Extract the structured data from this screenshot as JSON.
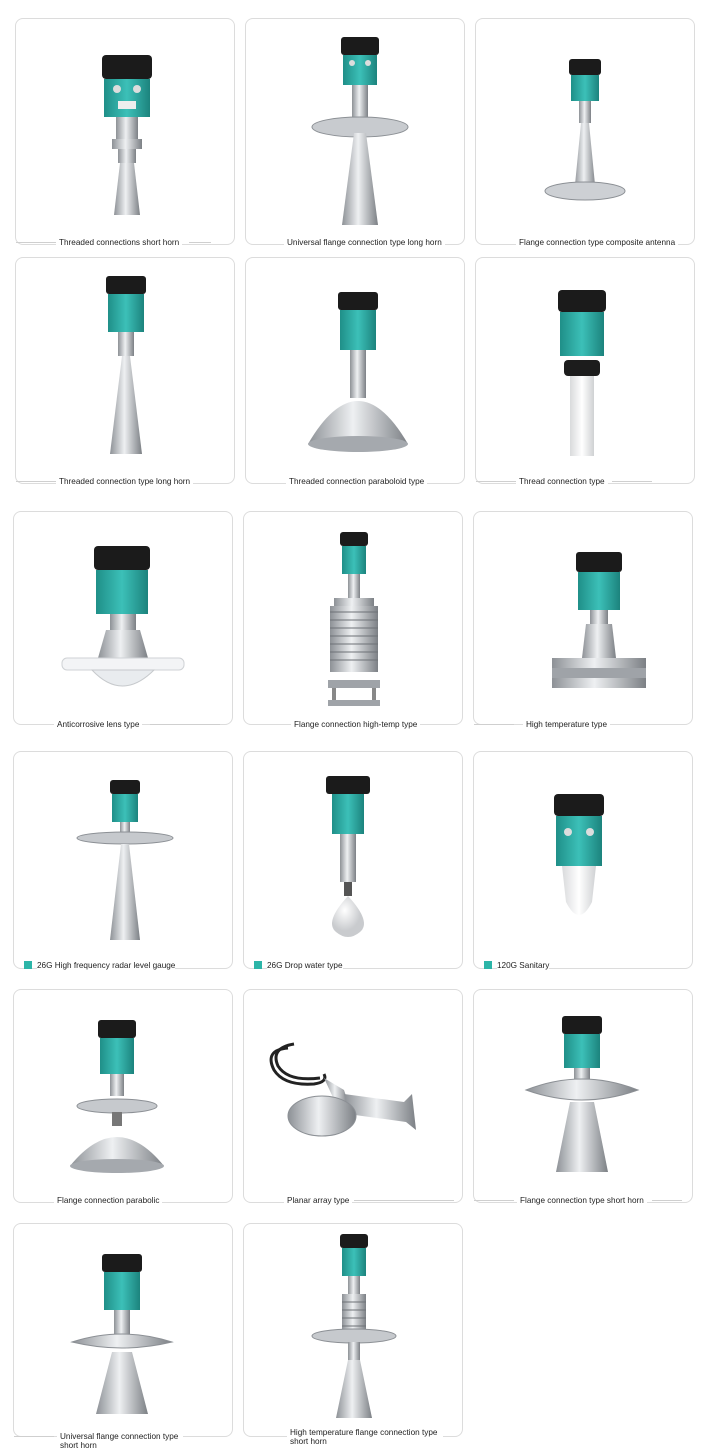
{
  "products": [
    {
      "label": "Threaded connections short horn",
      "tag": false,
      "antenna": "short-horn-thread"
    },
    {
      "label": "Universal flange connection type long horn",
      "tag": false,
      "antenna": "long-horn-flange"
    },
    {
      "label": "Flange connection type composite antenna",
      "tag": false,
      "antenna": "composite-flange"
    },
    {
      "label": "Threaded connection type long horn",
      "tag": false,
      "antenna": "long-horn-thread"
    },
    {
      "label": "Threaded connection paraboloid type",
      "tag": false,
      "antenna": "paraboloid-thread"
    },
    {
      "label": "Thread connection type",
      "tag": false,
      "antenna": "rod-thread"
    },
    {
      "label": "Anticorrosive lens type",
      "tag": false,
      "antenna": "lens"
    },
    {
      "label": "Flange connection high-temp type",
      "tag": false,
      "antenna": "bellows-hightemp"
    },
    {
      "label": "High temperature type",
      "tag": false,
      "antenna": "hightemp-flange"
    },
    {
      "label": "26G High frequency radar level gauge",
      "tag": true,
      "antenna": "26g-horn"
    },
    {
      "label": "26G Drop water type",
      "tag": true,
      "antenna": "drop"
    },
    {
      "label": "120G Sanitary",
      "tag": true,
      "antenna": "sanitary"
    },
    {
      "label": "Flange connection parabolic",
      "tag": false,
      "antenna": "parabolic-flange"
    },
    {
      "label": "Planar array type",
      "tag": false,
      "antenna": "planar"
    },
    {
      "label": "Flange connection type short horn",
      "tag": false,
      "antenna": "short-horn-flange"
    },
    {
      "label": "Universal flange connection type short horn",
      "tag": false,
      "antenna": "univ-short-horn"
    },
    {
      "label": "High temperature flange connection type short horn",
      "tag": false,
      "antenna": "hightemp-short-horn"
    }
  ],
  "colors": {
    "teal": "#2aa7a0",
    "tag": "#2cb5a8",
    "border": "#dcdcdc",
    "steel": "#b9bcc0"
  }
}
